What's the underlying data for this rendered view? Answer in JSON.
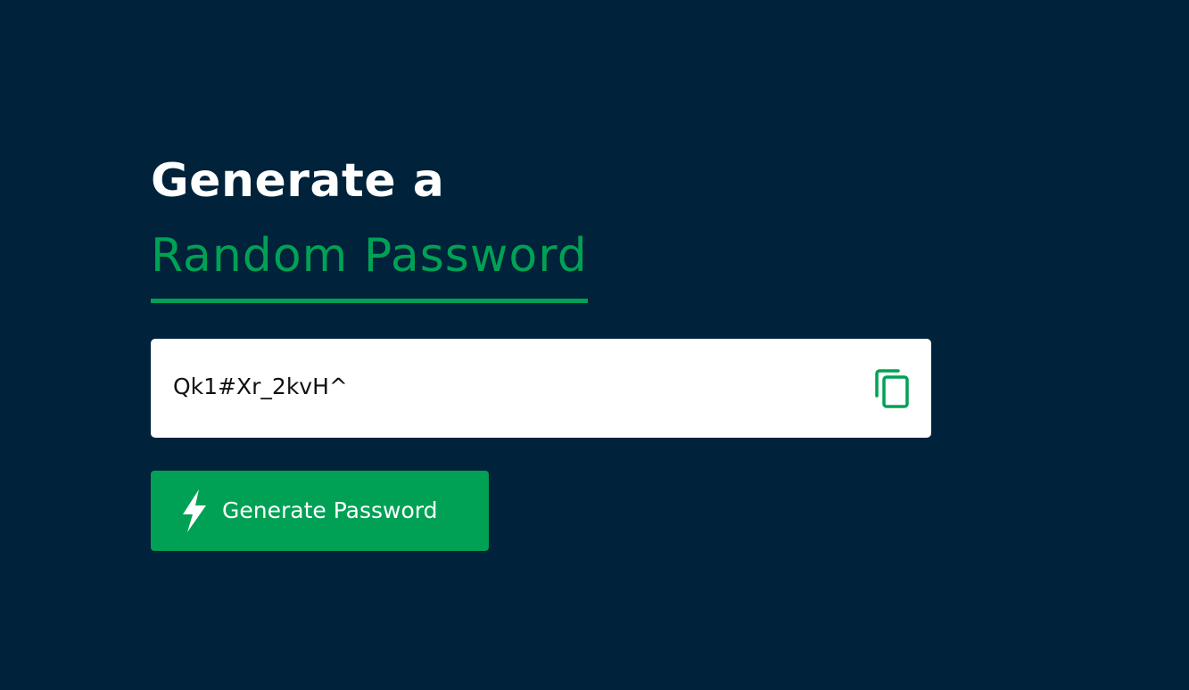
{
  "header": {
    "title_line1": "Generate a",
    "title_line2": "Random Password"
  },
  "password_field": {
    "value": "Qk1#Xr_2kvH^",
    "copy_icon": "copy-icon"
  },
  "generate_button": {
    "label": "Generate Password",
    "icon": "lightning-bolt-icon"
  },
  "colors": {
    "background": "#00223a",
    "accent": "#00a155",
    "field_background": "#ffffff",
    "title_text": "#ffffff"
  }
}
